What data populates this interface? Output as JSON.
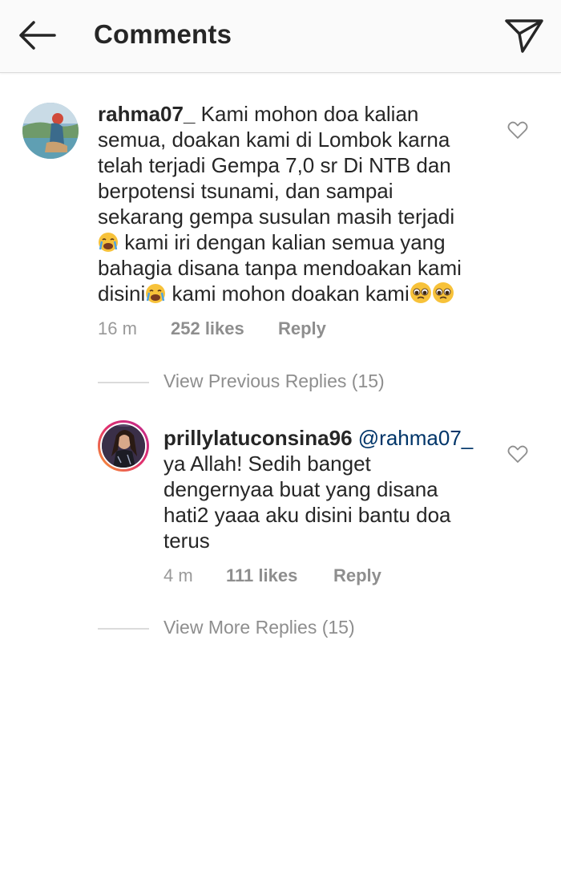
{
  "header": {
    "title": "Comments",
    "back_icon": "arrow-left-icon",
    "send_icon": "paper-plane-icon"
  },
  "comment": {
    "username": "rahma07_",
    "text_line1": "Kami mohon doa kalian",
    "text_line2": "semua, doakan kami di Lombok karna",
    "text_line3": "telah terjadi Gempa 7,0 sr  Di NTB dan",
    "text_line4": "berpotensi tsunami, dan sampai",
    "text_line5": "sekarang gempa susulan masih terjadi",
    "text_line6": "kami iri dengan kalian semua yang",
    "text_line7": "bahagia disana tanpa mendoakan kami",
    "text_line8a": "disini",
    "text_line8b": "kami mohon doakan kami",
    "time": "16 m",
    "likes": "252 likes",
    "reply": "Reply"
  },
  "view_previous": "View Previous Replies (15)",
  "reply_comment": {
    "username": "prillylatuconsina96",
    "mention": "@rahma07_",
    "text_line1": "ya Allah! Sedih banget",
    "text_line2": "dengernyaa buat yang disana",
    "text_line3": "hati2 yaaa aku disini bantu doa",
    "text_line4": "terus",
    "time": "4 m",
    "likes": "111 likes",
    "reply": "Reply"
  },
  "view_more": "View More Replies (15)",
  "colors": {
    "mention": "#003569",
    "meta": "#999999",
    "story_ring_start": "#f9a12e",
    "story_ring_end": "#bc2a8d"
  }
}
